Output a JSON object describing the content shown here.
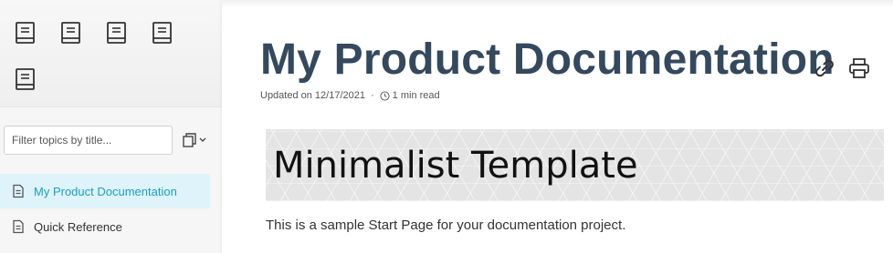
{
  "sidebar": {
    "book_icons": [
      "book-icon",
      "book-icon",
      "book-icon",
      "book-icon",
      "book-icon"
    ],
    "filter": {
      "placeholder": "Filter topics by title..."
    },
    "copy_dropdown_icon": "copy-icon",
    "items": [
      {
        "label": "My Product Documentation",
        "active": true
      },
      {
        "label": "Quick Reference",
        "active": false
      }
    ]
  },
  "main": {
    "title": "My Product Documentation",
    "meta": {
      "updated": "Updated on 12/17/2021",
      "separator": "·",
      "read_time": "1 min read"
    },
    "banner_title": "Minimalist Template",
    "intro": "This is a sample Start Page for your documentation project."
  },
  "colors": {
    "title": "#34495e",
    "active_bg": "#dff4fa",
    "active_text": "#1a9dc3"
  }
}
